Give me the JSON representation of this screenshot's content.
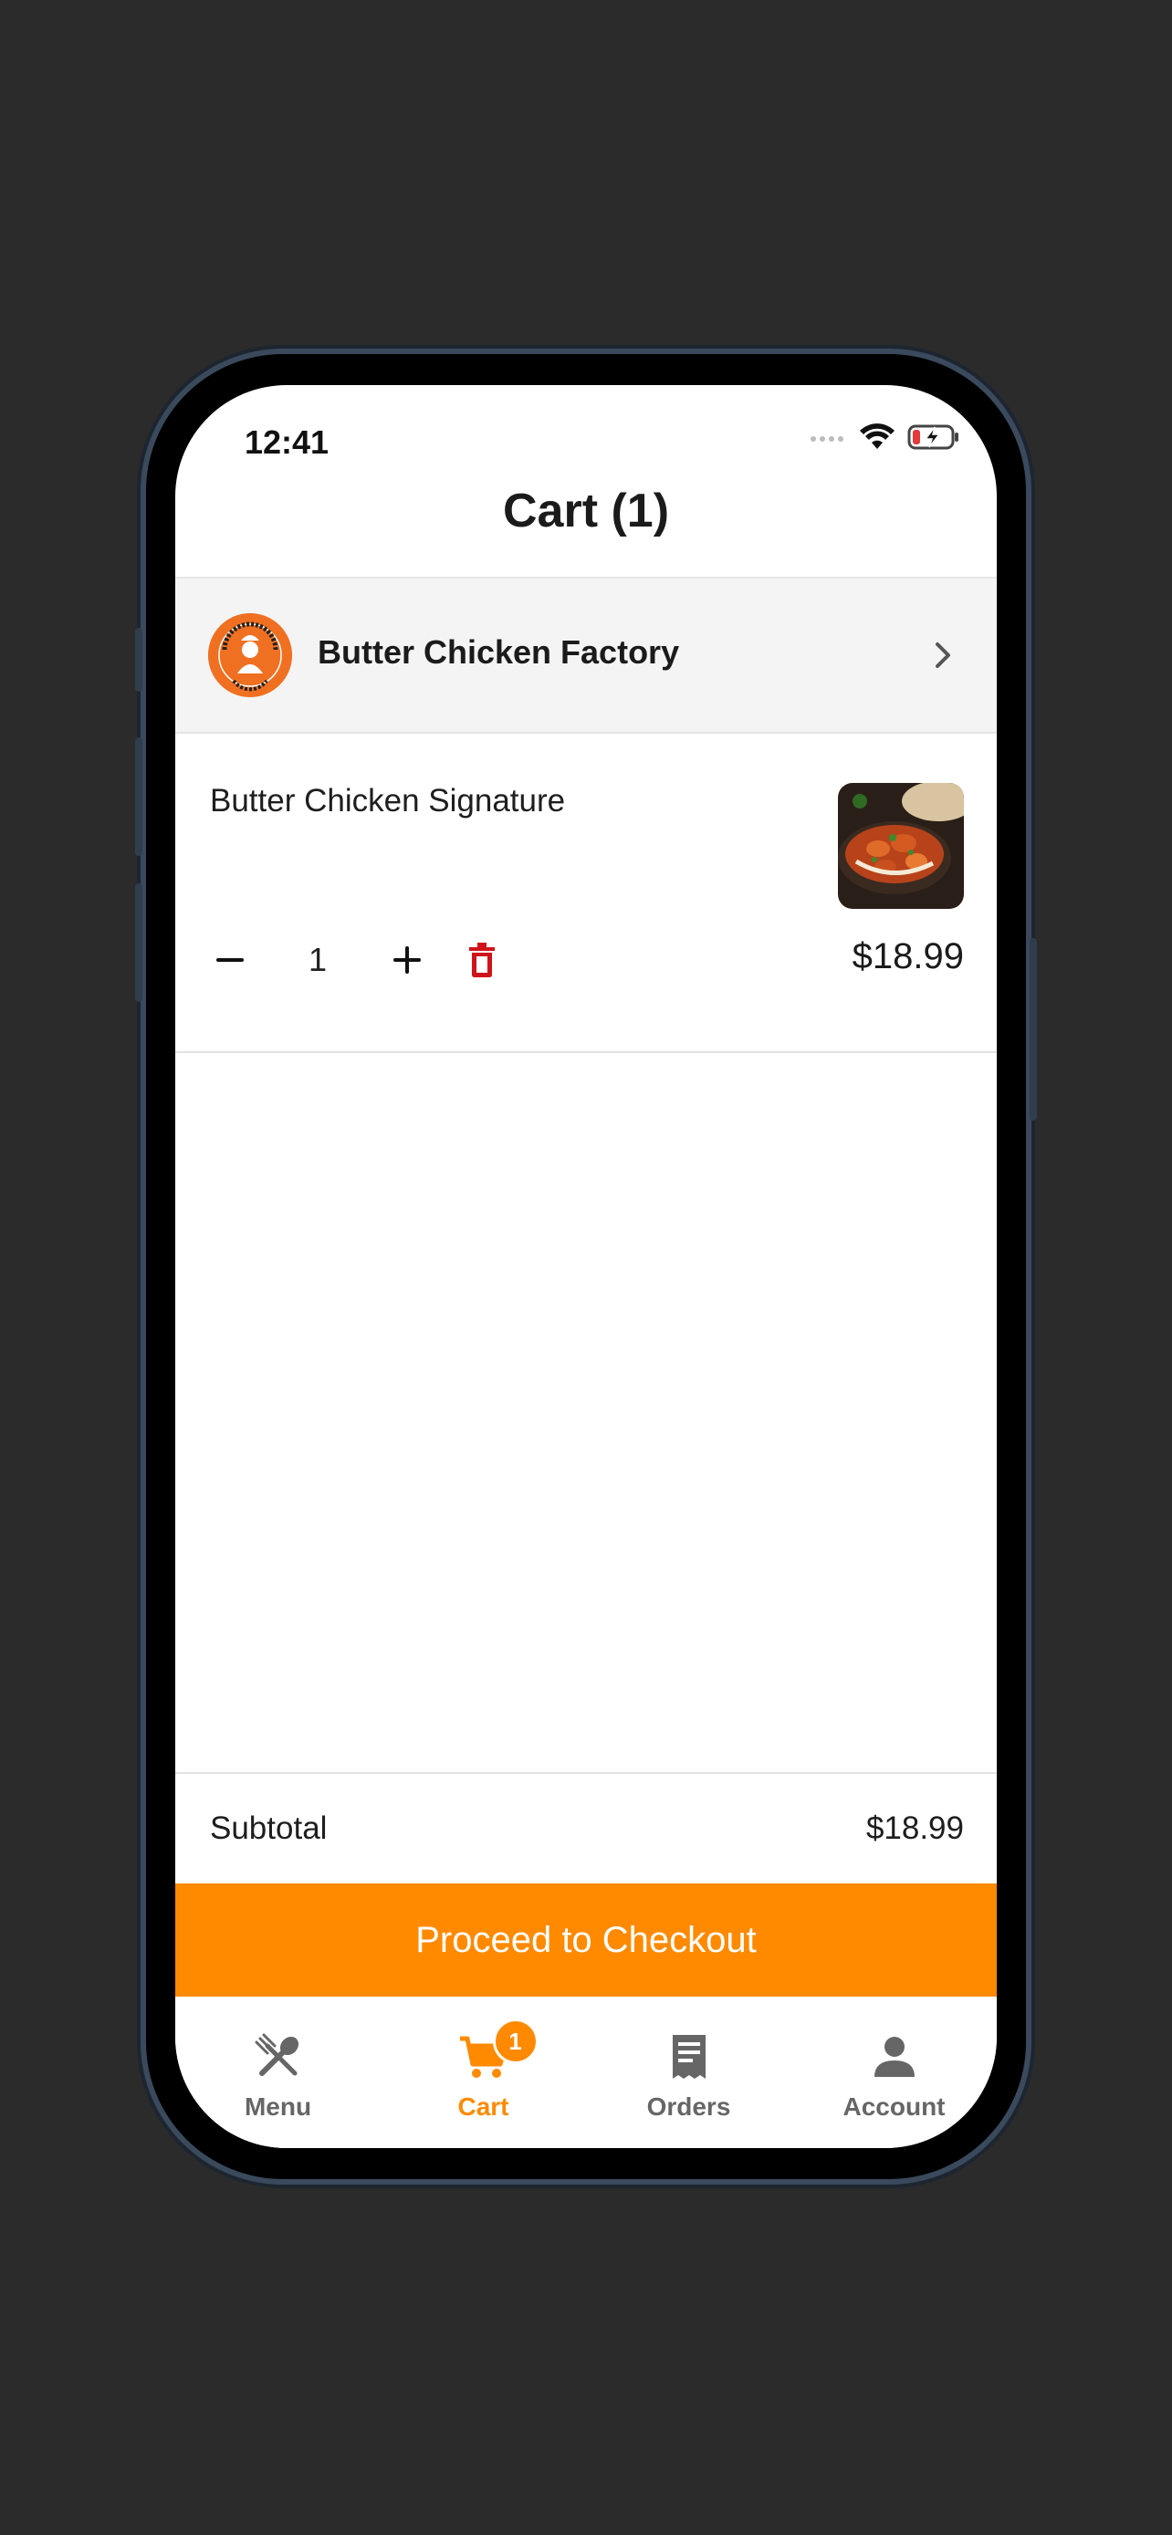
{
  "status_bar": {
    "time": "12:41"
  },
  "header": {
    "title": "Cart (1)"
  },
  "restaurant": {
    "name": "Butter Chicken Factory",
    "logo_text": "BUTTER CHICKEN FACTORY"
  },
  "cart_item": {
    "name": "Butter Chicken Signature",
    "quantity": "1",
    "price": "$18.99"
  },
  "summary": {
    "subtotal_label": "Subtotal",
    "subtotal_value": "$18.99"
  },
  "checkout_button": {
    "label": "Proceed to Checkout"
  },
  "tabs": [
    {
      "label": "Menu",
      "icon": "fork-spoon-icon",
      "active": false
    },
    {
      "label": "Cart",
      "icon": "cart-icon",
      "active": true,
      "badge": "1"
    },
    {
      "label": "Orders",
      "icon": "receipt-icon",
      "active": false
    },
    {
      "label": "Account",
      "icon": "person-icon",
      "active": false
    }
  ],
  "colors": {
    "accent": "#ff8a00",
    "delete": "#d0131a",
    "logo_bg": "#f07022"
  }
}
